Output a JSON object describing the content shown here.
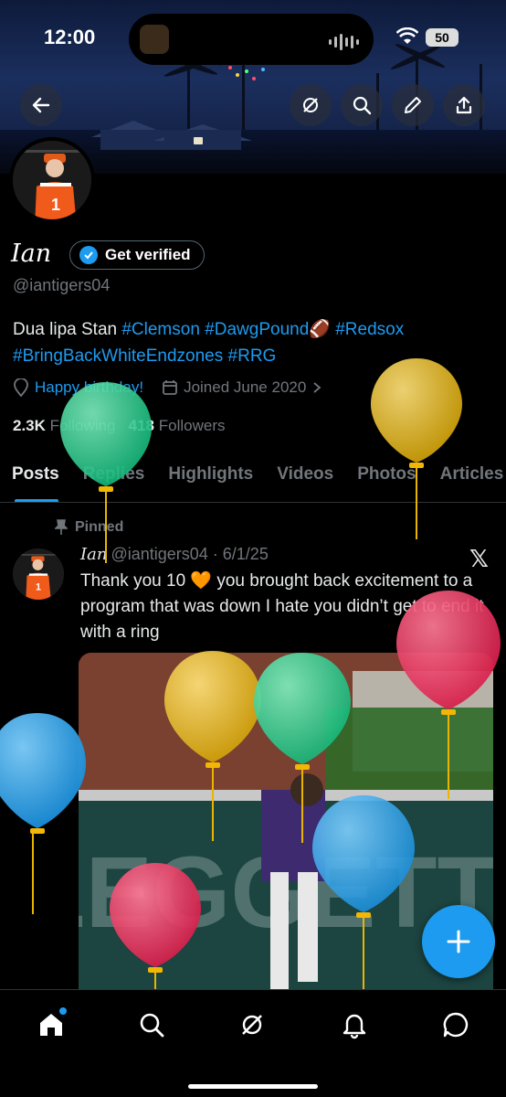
{
  "status_bar": {
    "time": "12:00",
    "battery": "50"
  },
  "profile": {
    "name": "Ian",
    "verify_label": "Get verified",
    "handle": "@iantigers04",
    "bio_text": "Dua lipa Stan ",
    "bio_tags": [
      "#Clemson",
      "#DawgPound",
      "#Redsox",
      "#BringBackWhiteEndzones",
      "#RRG"
    ],
    "birthday": "Happy birthday!",
    "joined": "Joined June 2020",
    "following_count": "2.3K",
    "following_label": "Following",
    "followers_count": "418",
    "followers_label": "Followers"
  },
  "tabs": [
    {
      "label": "Posts",
      "active": true
    },
    {
      "label": "Replies",
      "active": false
    },
    {
      "label": "Highlights",
      "active": false
    },
    {
      "label": "Videos",
      "active": false
    },
    {
      "label": "Photos",
      "active": false
    },
    {
      "label": "Articles",
      "active": false
    }
  ],
  "post": {
    "pinned_label": "Pinned",
    "author": "Ian",
    "handle": "@iantigers04",
    "date": "6/1/25",
    "text": "Thank you 10 🧡 you brought back excitement to a program that was down I hate you didn’t get to end it with a ring",
    "image_wall_text": "LEGGETT"
  },
  "colors": {
    "accent": "#1d9bf0",
    "background": "#000000",
    "muted": "#71767b"
  },
  "icons": [
    "back-arrow-icon",
    "grok-icon",
    "search-icon",
    "pencil-icon",
    "share-icon",
    "home-icon",
    "notifications-icon",
    "messages-icon",
    "compose-plus-icon",
    "x-logo-icon",
    "pin-icon",
    "location-icon",
    "calendar-icon",
    "verified-badge-icon"
  ]
}
